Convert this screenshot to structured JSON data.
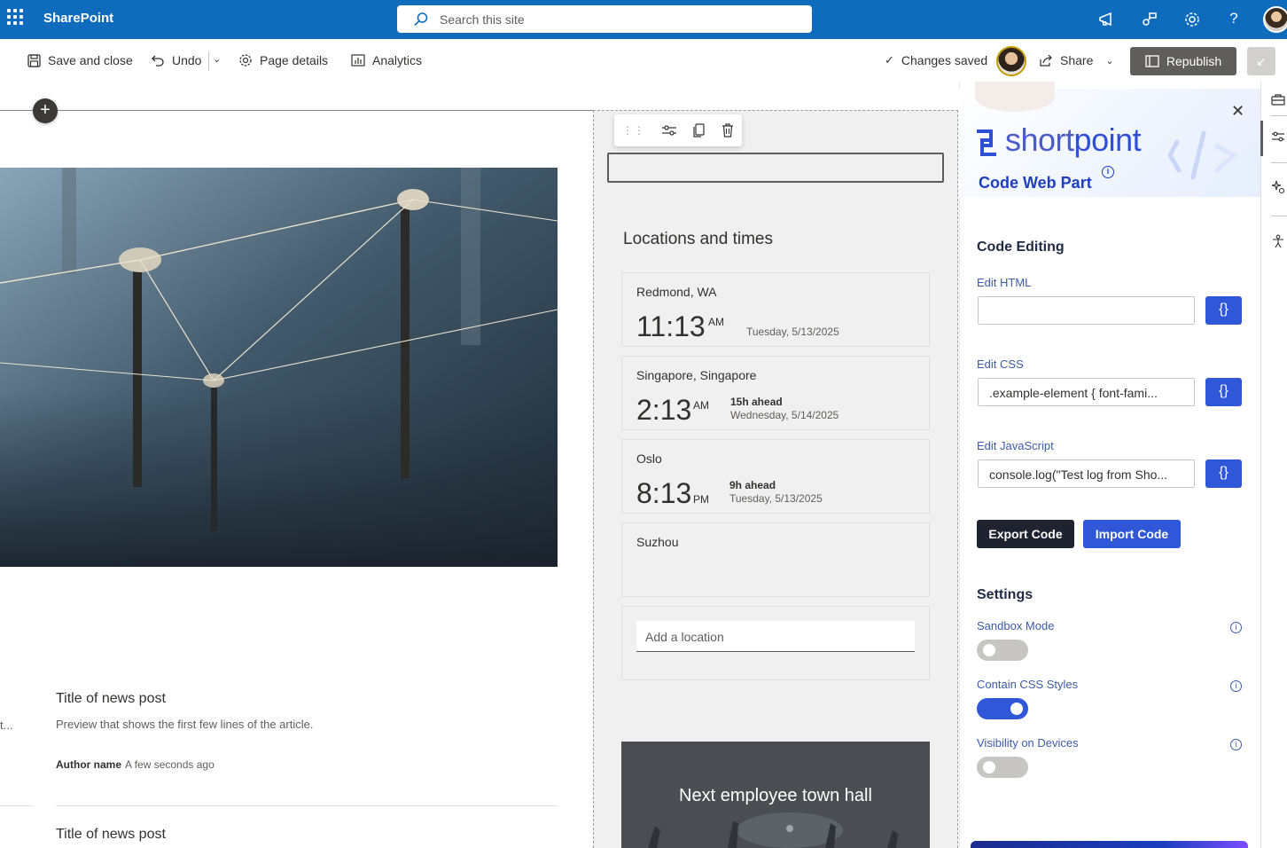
{
  "suite": {
    "brand": "SharePoint",
    "search_placeholder": "Search this site"
  },
  "commandbar": {
    "save_close": "Save and close",
    "undo": "Undo",
    "page_details": "Page details",
    "analytics": "Analytics",
    "changes_saved": "Changes saved",
    "share": "Share",
    "republish": "Republish"
  },
  "news": {
    "items": [
      {
        "title": "Title of news post",
        "preview": "Preview that shows the first few lines of the article.",
        "author": "Author name",
        "time": "A few seconds ago"
      },
      {
        "title": "Title of news post"
      }
    ],
    "truncated": "t..."
  },
  "world_clock": {
    "heading": "Locations and times",
    "locations": [
      {
        "city": "Redmond, WA",
        "time": "11:13",
        "ampm": "AM",
        "ahead": "",
        "date": "Tuesday, 5/13/2025"
      },
      {
        "city": "Singapore, Singapore",
        "time": "2:13",
        "ampm": "AM",
        "ahead": "15h ahead",
        "date": "Wednesday, 5/14/2025"
      },
      {
        "city": "Oslo",
        "time": "8:13",
        "ampm": "PM",
        "ahead": "9h ahead",
        "date": "Tuesday, 5/13/2025"
      },
      {
        "city": "Suzhou"
      }
    ],
    "add_location_placeholder": "Add a location"
  },
  "event": {
    "title": "Next employee town hall"
  },
  "panel": {
    "logo_a": "short",
    "logo_b": "point",
    "title": "Code Web Part",
    "code_editing_heading": "Code Editing",
    "edit_html_label": "Edit HTML",
    "edit_html_value": "",
    "edit_css_label": "Edit CSS",
    "edit_css_value": ".example-element {   font-fami...",
    "edit_js_label": "Edit JavaScript",
    "edit_js_value": "console.log(\"Test log from Sho...",
    "brace_label": "{}",
    "export_code": "Export Code",
    "import_code": "Import Code",
    "settings_heading": "Settings",
    "sandbox_mode": "Sandbox Mode",
    "contain_css": "Contain CSS Styles",
    "visibility": "Visibility on Devices",
    "toggles": {
      "sandbox": false,
      "contain_css": true,
      "visibility": false
    }
  },
  "colors": {
    "suite_blue": "#0f6cbd",
    "accent_blue": "#2f57d8",
    "dark_button": "#1f2330"
  }
}
